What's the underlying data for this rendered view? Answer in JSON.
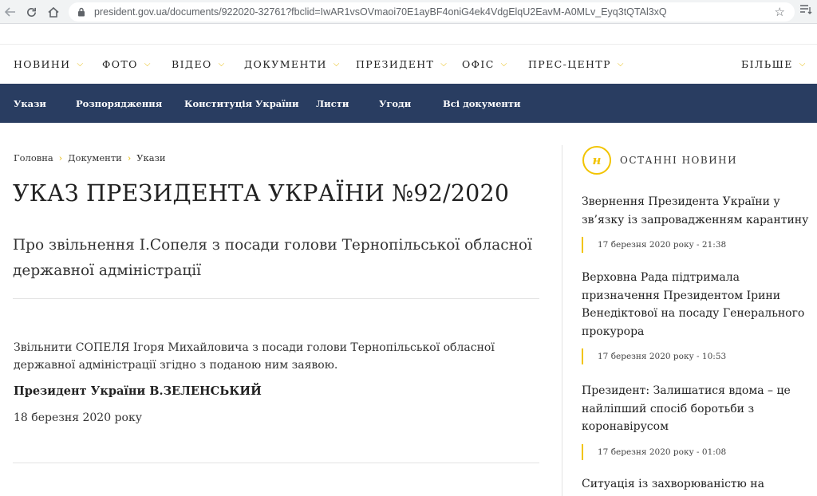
{
  "browser": {
    "url": "president.gov.ua/documents/922020-32761?fbclid=IwAR1vsOVmaoi70E1ayBF4oniG4ek4VdgElqU2EavM-A0MLv_Eyq3tQTAl3xQ",
    "back_icon": "back-arrow-icon",
    "home_icon": "home-icon",
    "refresh_icon": "refresh-icon",
    "lock_icon": "lock-icon",
    "star_icon": "star-icon"
  },
  "main_nav": {
    "items": [
      "НОВИНИ",
      "ФОТО",
      "ВІДЕО",
      "ДОКУМЕНТИ",
      "ПРЕЗИДЕНТ",
      "ОФІС",
      "ПРЕС-ЦЕНТР"
    ],
    "more": "БІЛЬШЕ"
  },
  "sub_nav": {
    "items": [
      "Укази",
      "Розпорядження",
      "Конституція України",
      "Листи",
      "Угоди",
      "Всі документи"
    ]
  },
  "breadcrumb": [
    "Головна",
    "Документи",
    "Укази"
  ],
  "document": {
    "title": "УКАЗ ПРЕЗИДЕНТА УКРАЇНИ №92/2020",
    "subtitle": "Про звільнення І.Сопеля з посади голови Тернопільської обласної державної адміністрації",
    "body": "Звільнити СОПЕЛЯ Ігоря Михайловича з посади голови Тернопільської обласної державної адміністрації згідно з поданою ним заявою.",
    "signature": "Президент України В.ЗЕЛЕНСЬКИЙ",
    "date": "18 березня 2020 року"
  },
  "sidebar": {
    "badge": "н",
    "heading": "ОСТАННІ НОВИНИ",
    "news": [
      {
        "headline": "Звернення Президента України у зв’язку із запровадженням карантину",
        "meta": "17 березня 2020 року - 21:38"
      },
      {
        "headline": "Верховна Рада підтримала призначення Президентом Ірини Венедіктової на посаду Генерального прокурора",
        "meta": "17 березня 2020 року - 10:53"
      },
      {
        "headline": "Президент: Залишатися вдома – це найліпший спосіб боротьби з коронавірусом",
        "meta": "17 березня 2020 року - 01:08"
      },
      {
        "headline": "Ситуація із захворюваністю на",
        "meta": ""
      }
    ]
  },
  "colors": {
    "accent": "#f2c400",
    "subnav_bg": "#293d61"
  }
}
